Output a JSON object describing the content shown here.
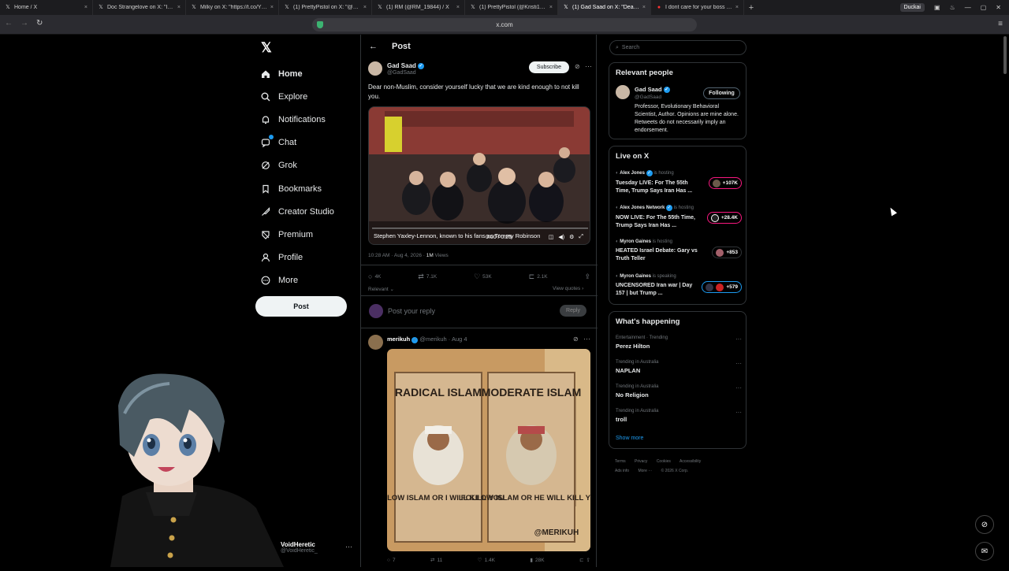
{
  "browser": {
    "tabs": [
      {
        "title": "Home / X",
        "icon": "x-logo-icon"
      },
      {
        "title": "Doc Strangelove on X: \"It's actually",
        "icon": "x-logo-icon"
      },
      {
        "title": "Milky on X: \"https://t.co/YJ5A1O0",
        "icon": "x-logo-icon"
      },
      {
        "title": "(1) PrettyPistol on X: \"@RM_19844",
        "icon": "x-logo-icon"
      },
      {
        "title": "(1) RM (@RM_19844) / X",
        "icon": "x-logo-icon"
      },
      {
        "title": "(1) PrettyPistol (@Kristi1951975",
        "icon": "x-logo-icon"
      },
      {
        "title": "(1) Gad Saad on X: \"Dear non",
        "icon": "x-logo-icon",
        "active": true
      },
      {
        "title": "I dont care for your boss cause",
        "icon": "youtube-icon"
      }
    ],
    "new_tab": "+",
    "profile_label": "Duckai",
    "url": "x.com"
  },
  "sidebar": {
    "items": [
      {
        "label": "Home",
        "icon": "home-icon"
      },
      {
        "label": "Explore",
        "icon": "search-icon"
      },
      {
        "label": "Notifications",
        "icon": "bell-icon"
      },
      {
        "label": "Chat",
        "icon": "chat-icon"
      },
      {
        "label": "Grok",
        "icon": "grok-icon"
      },
      {
        "label": "Bookmarks",
        "icon": "bookmark-icon"
      },
      {
        "label": "Creator Studio",
        "icon": "creator-studio-icon"
      },
      {
        "label": "Premium",
        "icon": "premium-icon"
      },
      {
        "label": "Profile",
        "icon": "profile-icon"
      },
      {
        "label": "More",
        "icon": "more-circle-icon"
      }
    ],
    "post_button": "Post",
    "account": {
      "name": "VoidHeretic",
      "handle": "@VoidHeretic_"
    }
  },
  "main": {
    "header_title": "Post",
    "post": {
      "author": "Gad Saad",
      "handle": "@GadSaad",
      "subscribe": "Subscribe",
      "text": "Dear non-Muslim, consider yourself lucky that we are kind enough to not kill you.",
      "video_caption": "Stephen Yaxley-Lennon, known to his fans as Tommy Robinson",
      "video_time": "0:00 / 0:25",
      "timestamp": "10:28 AM · Aug 4, 2026 · ",
      "views": "1M",
      "views_label": " Views",
      "stats": {
        "replies": "4K",
        "reposts": "7.1K",
        "likes": "53K",
        "bookmarks": "2.1K"
      },
      "sort_label": "Relevant",
      "view_quotes": "View quotes"
    },
    "reply_box": {
      "placeholder": "Post your reply",
      "button": "Reply"
    },
    "reply": {
      "author": "merikuh",
      "handle": "@merikuh",
      "date": "Aug 4",
      "image": {
        "left_title": "RADICAL ISLAM",
        "right_title": "MODERATE ISLAM",
        "left_caption": "FOLLOW ISLAM OR I WILL KILL YOU",
        "right_caption": "FOLLOW ISLAM OR HE WILL KILL YOU",
        "watermark": "@MERIKUH"
      },
      "stats": {
        "replies": "7",
        "reposts": "11",
        "likes": "1.4K",
        "views": "28K"
      }
    }
  },
  "right": {
    "search_placeholder": "Search",
    "relevant_people": {
      "title": "Relevant people",
      "name": "Gad Saad",
      "handle": "@GadSaad",
      "button": "Following",
      "bio": "Professor, Evolutionary Behavioral Scientist, Author. Opinions are mine alone. Retweets do not necessarily imply an endorsement."
    },
    "live": {
      "title": "Live on X",
      "items": [
        {
          "host": "Alex Jones",
          "status": "is hosting",
          "title": "Tuesday LIVE: For The 55th Time, Trump Says Iran Has ...",
          "count": "+107K"
        },
        {
          "host": "Alex Jones Network",
          "status": "is hosting",
          "title": "NOW LIVE: For The 55th Time, Trump Says Iran Has ...",
          "count": "+28.4K"
        },
        {
          "host": "Myron Gaines",
          "status": "is hosting",
          "title": "HEATED Israel Debate: Gary vs Truth Teller",
          "count": "+853"
        },
        {
          "host": "Myron Gaines",
          "status": "is speaking",
          "title": "UNCENSORED Iran war | Day 157 | but Trump ...",
          "count": "+579"
        }
      ]
    },
    "happening": {
      "title": "What's happening",
      "trends": [
        {
          "category": "Entertainment · Trending",
          "name": "Perez Hilton"
        },
        {
          "category": "Trending in Australia",
          "name": "NAPLAN"
        },
        {
          "category": "Trending in Australia",
          "name": "No Religion"
        },
        {
          "category": "Trending in Australia",
          "name": "troll"
        }
      ],
      "show_more": "Show more"
    },
    "footer": {
      "links": [
        "Terms",
        "Privacy",
        "Cookies",
        "Accessibility",
        "Ads info",
        "More ···"
      ],
      "copyright": "© 2026 X Corp."
    }
  }
}
